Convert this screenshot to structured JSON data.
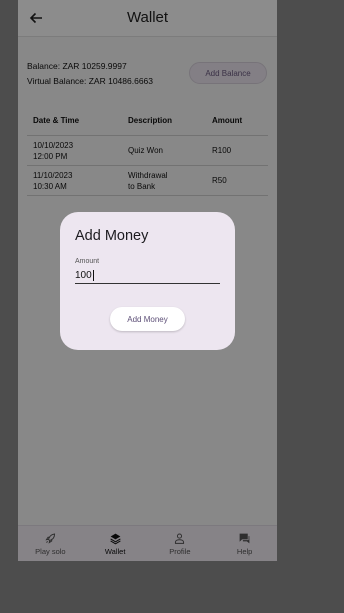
{
  "appbar": {
    "title": "Wallet",
    "back_icon": "arrow-left-icon"
  },
  "balance": {
    "balance_text": "Balance: ZAR 10259.9997",
    "virtual_text": "Virtual Balance: ZAR 10486.6663",
    "add_button_label": "Add Balance"
  },
  "table": {
    "headers": [
      "Date & Time",
      "Description",
      "Amount"
    ],
    "rows": [
      {
        "date": "10/10/2023",
        "time": "12:00 PM",
        "desc1": "Quiz Won",
        "desc2": "",
        "amount": "R100"
      },
      {
        "date": "11/10/2023",
        "time": "10:30 AM",
        "desc1": "Withdrawal",
        "desc2": "to Bank",
        "amount": "R50"
      }
    ]
  },
  "dialog": {
    "title": "Add Money",
    "field_label": "Amount",
    "field_value": "100",
    "button_label": "Add Money"
  },
  "nav": {
    "items": [
      {
        "label": "Play solo",
        "icon": "rocket-icon"
      },
      {
        "label": "Wallet",
        "icon": "layers-icon"
      },
      {
        "label": "Profile",
        "icon": "person-icon"
      },
      {
        "label": "Help",
        "icon": "chat-icon"
      }
    ],
    "active": "Wallet"
  }
}
